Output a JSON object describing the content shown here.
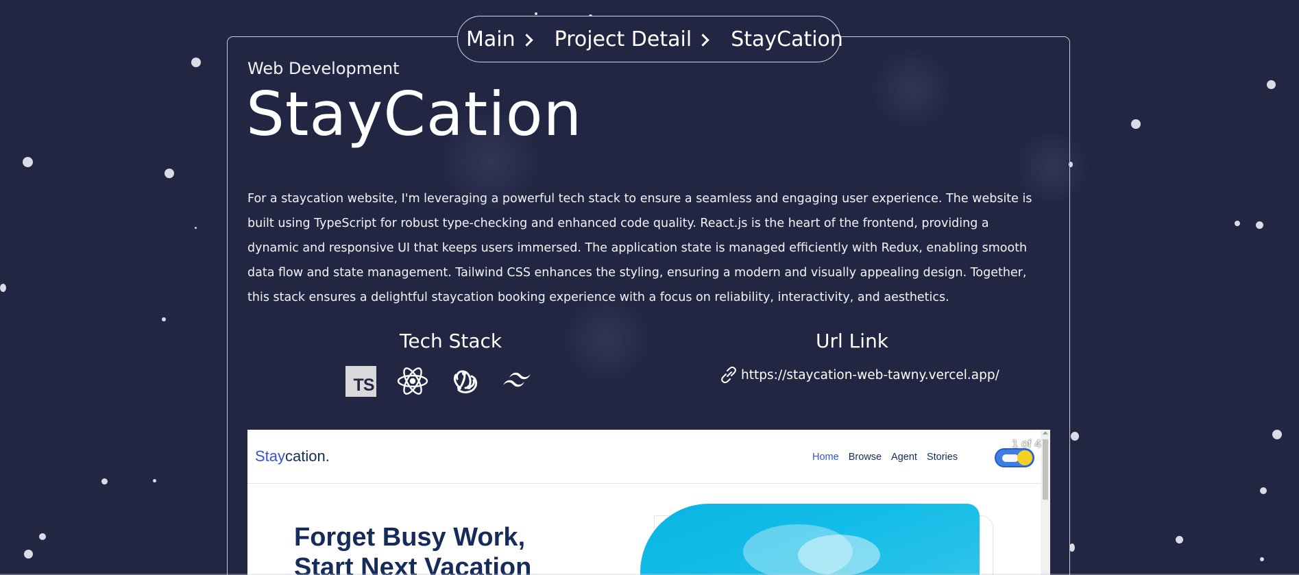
{
  "breadcrumb": {
    "items": [
      "Main",
      "Project Detail",
      "StayCation"
    ]
  },
  "project": {
    "category": "Web Development",
    "title": "StayCation",
    "description": "For a staycation website, I'm leveraging a powerful tech stack to ensure a seamless and engaging user experience. The website is built using TypeScript for robust type-checking and enhanced code quality. React.js is the heart of the frontend, providing a dynamic and responsive UI that keeps users immersed. The application state is managed efficiently with Redux, enabling smooth data flow and state management. Tailwind CSS enhances the styling, ensuring a modern and visually appealing design. Together, this stack ensures a delightful staycation booking experience with a focus on reliability, interactivity, and aesthetics."
  },
  "tech_stack": {
    "heading": "Tech Stack",
    "icons": [
      {
        "name": "typescript-icon",
        "label": "TS"
      },
      {
        "name": "react-icon"
      },
      {
        "name": "redux-icon"
      },
      {
        "name": "tailwind-icon"
      }
    ]
  },
  "url_section": {
    "heading": "Url Link",
    "url": "https://staycation-web-tawny.vercel.app/"
  },
  "preview": {
    "logo_accent": "Stay",
    "logo_rest": "cation.",
    "menu": [
      "Home",
      "Browse",
      "Agent",
      "Stories"
    ],
    "counter": "1 of 4",
    "headline_line1": "Forget Busy Work,",
    "headline_line2": "Start Next Vacation"
  },
  "colors": {
    "background": "#232643",
    "accent_blue": "#3252df",
    "navy_text": "#152c5b"
  }
}
